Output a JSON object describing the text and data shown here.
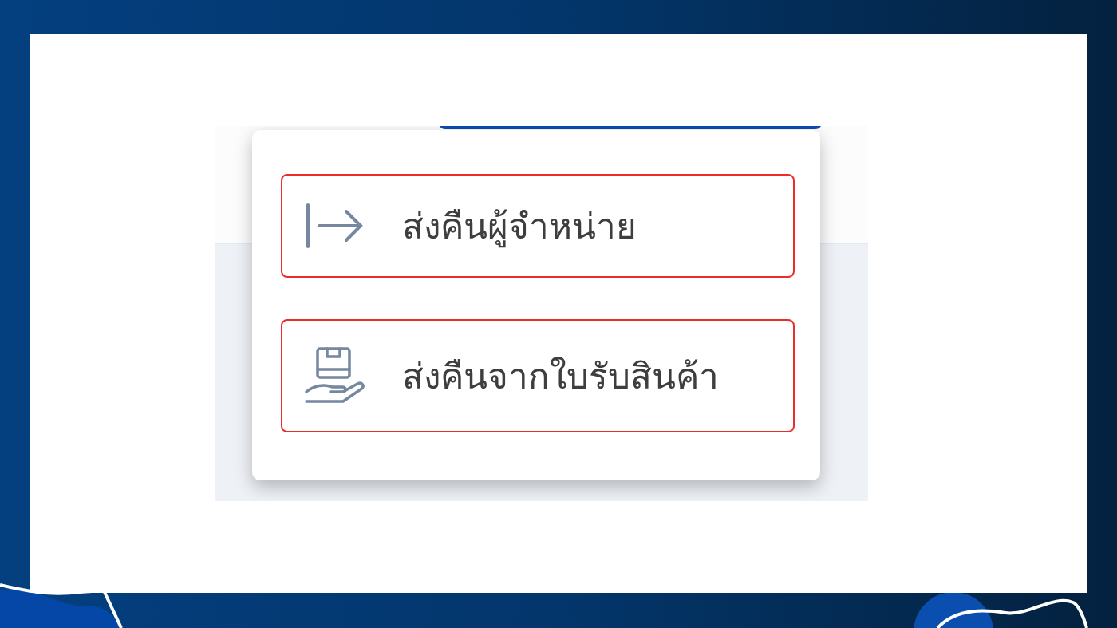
{
  "menu": {
    "items": [
      {
        "kind": "arrow",
        "label": "ส่งคืนผู้จำหน่าย",
        "highlighted": true
      },
      {
        "kind": "package",
        "label": "ส่งคืนจากใบรับสินค้า",
        "highlighted": true
      }
    ]
  }
}
